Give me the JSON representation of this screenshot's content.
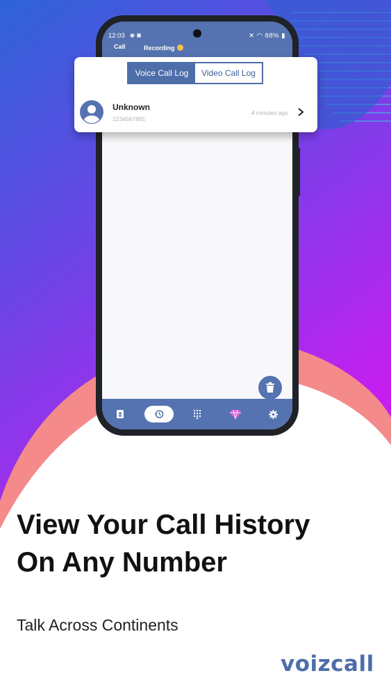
{
  "statusbar": {
    "time": "12:03",
    "battery": "88%",
    "tab_call": "Call",
    "tab_recording": "Recording"
  },
  "card": {
    "tabs": [
      "Voice Call Log",
      "Video Call Log"
    ],
    "active_tab": "Voice Call Log",
    "entry": {
      "name": "Unknown",
      "number": "1234567891",
      "time": "4 minutes ago"
    }
  },
  "bottom_nav": {
    "items": [
      "contacts-icon",
      "history-icon",
      "dialpad-icon",
      "premium-icon",
      "settings-icon"
    ],
    "active": "history-icon"
  },
  "promo": {
    "headline_line1": "View Your Call History",
    "headline_line2": "On Any Number",
    "subline": "Talk Across Continents",
    "brand": "voizcall"
  },
  "colors": {
    "accent": "#4e6ea9",
    "bg_blue": "#3a5ed6",
    "bg_purple": "#b021ee",
    "salmon": "#f48a8a"
  }
}
